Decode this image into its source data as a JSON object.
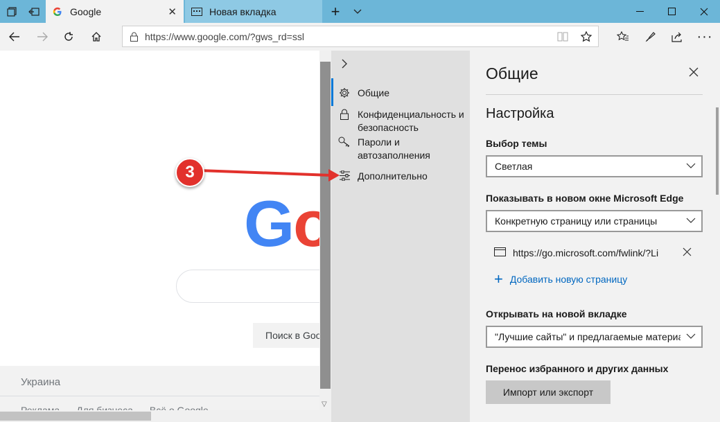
{
  "titlebar": {
    "tabs": [
      {
        "label": "Google",
        "active": true
      },
      {
        "label": "Новая вкладка",
        "active": false
      }
    ]
  },
  "navbar": {
    "url": "https://www.google.com/?gws_rd=ssl"
  },
  "google_page": {
    "logo_visible": "Go",
    "search_button": "Поиск в Goo",
    "country": "Украина",
    "footer_links": [
      "Реклама",
      "Для бизнеса",
      "Всё о Google"
    ]
  },
  "settings_nav": {
    "items": [
      {
        "label": "Общие",
        "icon": "gear-icon"
      },
      {
        "label": "Конфиденциальность и безопасность",
        "icon": "lock-icon"
      },
      {
        "label": "Пароли и автозаполнения",
        "icon": "key-icon"
      },
      {
        "label": "Дополнительно",
        "icon": "sliders-icon"
      }
    ]
  },
  "settings_panel": {
    "title": "Общие",
    "section": "Настройка",
    "theme_label": "Выбор темы",
    "theme_value": "Светлая",
    "startup_label": "Показывать в новом окне Microsoft Edge",
    "startup_value": "Конкретную страницу или страницы",
    "startup_page_url": "https://go.microsoft.com/fwlink/?LinkId",
    "add_page": "Добавить новую страницу",
    "newtab_label": "Открывать на новой вкладке",
    "newtab_value": "\"Лучшие сайты\" и предлагаемые материа",
    "import_label": "Перенос избранного и других данных",
    "import_button": "Импорт или экспорт"
  },
  "annotation": {
    "badge": "3"
  },
  "colors": {
    "titlebar": "#6cb6d8",
    "accent": "#0078d7",
    "badge": "#e2312c"
  }
}
